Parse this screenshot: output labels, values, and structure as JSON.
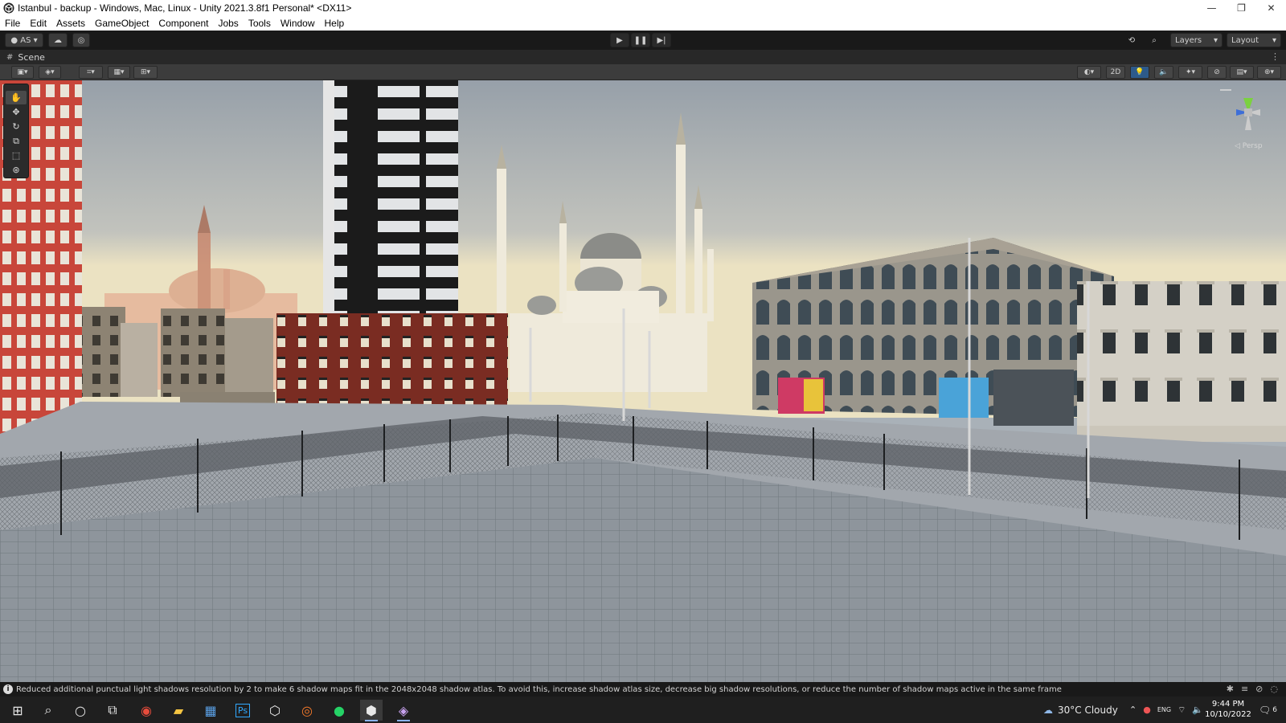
{
  "window": {
    "title": "Istanbul - backup - Windows, Mac, Linux - Unity 2021.3.8f1 Personal* <DX11>",
    "minimize_icon": "minimize-icon",
    "maximize_icon": "restore-icon",
    "close_icon": "close-icon"
  },
  "menu": [
    "File",
    "Edit",
    "Assets",
    "GameObject",
    "Component",
    "Jobs",
    "Tools",
    "Window",
    "Help"
  ],
  "toolbar": {
    "account_label": "AS",
    "layers_label": "Layers",
    "layout_label": "Layout"
  },
  "scene": {
    "tab_label": "Scene",
    "mode_2d_label": "2D",
    "orientation_hint": "◁ Persp"
  },
  "status": {
    "message": "Reduced additional punctual light shadows resolution by 2 to make 6 shadow maps fit in the 2048x2048 shadow atlas. To avoid this, increase shadow atlas size, decrease big shadow resolutions, or reduce the number of shadow maps active in the same frame"
  },
  "taskbar": {
    "weather": "30°C  Cloudy",
    "time": "9:44 PM",
    "date": "10/10/2022",
    "notifications": "6",
    "ime": "ENG"
  },
  "colors": {
    "sky_top": "#99a1aa",
    "sky_horizon": "#e9e1c2",
    "ground": "#8f959c",
    "brick_red": "#7a2c22",
    "red_tower": "#c9453a",
    "mosque": "#efeadb",
    "unity_dark": "#191919"
  }
}
